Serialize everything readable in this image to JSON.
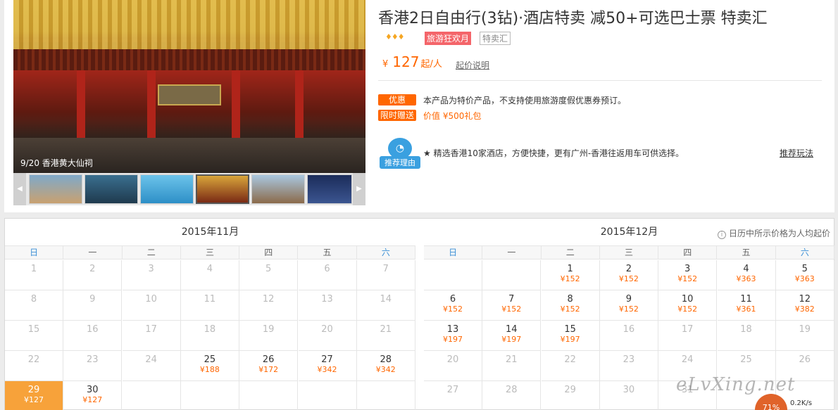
{
  "product": {
    "title": "香港2日自由行(3钻)·酒店特卖 减50+可选巴士票 特卖汇",
    "diamonds": "♦♦♦",
    "tag_promo": "旅游狂欢月",
    "tag_sale": "特卖汇",
    "price_currency": "¥",
    "price_value": "127",
    "price_unit": "起/人",
    "price_note": "起价说明",
    "discount_label": "优惠",
    "discount_text": "本产品为特价产品，不支持使用旅游度假优惠券预订。",
    "gift_label": "限时赠送",
    "gift_text": "价值 ¥500礼包",
    "reason_label": "推荐理由",
    "reason_text": "★ 精选香港10家酒店，方便快捷，更有广州-香港往返用车可供选择。",
    "reason_link": "推荐玩法",
    "hero_caption": "9/20 香港黄大仙祠"
  },
  "calendar": {
    "note": "日历中所示价格为人均起价",
    "weekdays": [
      "日",
      "一",
      "二",
      "三",
      "四",
      "五",
      "六"
    ],
    "months": [
      {
        "title": "2015年11月",
        "rows": [
          [
            {
              "d": "1"
            },
            {
              "d": "2"
            },
            {
              "d": "3"
            },
            {
              "d": "4"
            },
            {
              "d": "5"
            },
            {
              "d": "6"
            },
            {
              "d": "7"
            }
          ],
          [
            {
              "d": "8"
            },
            {
              "d": "9"
            },
            {
              "d": "10"
            },
            {
              "d": "11"
            },
            {
              "d": "12"
            },
            {
              "d": "13"
            },
            {
              "d": "14"
            }
          ],
          [
            {
              "d": "15"
            },
            {
              "d": "16"
            },
            {
              "d": "17"
            },
            {
              "d": "18"
            },
            {
              "d": "19"
            },
            {
              "d": "20"
            },
            {
              "d": "21"
            }
          ],
          [
            {
              "d": "22"
            },
            {
              "d": "23"
            },
            {
              "d": "24"
            },
            {
              "d": "25",
              "p": "¥188"
            },
            {
              "d": "26",
              "p": "¥172"
            },
            {
              "d": "27",
              "p": "¥342"
            },
            {
              "d": "28",
              "p": "¥342"
            }
          ],
          [
            {
              "d": "29",
              "p": "¥127",
              "sel": true
            },
            {
              "d": "30",
              "p": "¥127"
            },
            {
              "d": ""
            },
            {
              "d": ""
            },
            {
              "d": ""
            },
            {
              "d": ""
            },
            {
              "d": ""
            }
          ]
        ]
      },
      {
        "title": "2015年12月",
        "rows": [
          [
            {
              "d": ""
            },
            {
              "d": ""
            },
            {
              "d": "1",
              "p": "¥152"
            },
            {
              "d": "2",
              "p": "¥152"
            },
            {
              "d": "3",
              "p": "¥152"
            },
            {
              "d": "4",
              "p": "¥363"
            },
            {
              "d": "5",
              "p": "¥363"
            }
          ],
          [
            {
              "d": "6",
              "p": "¥152"
            },
            {
              "d": "7",
              "p": "¥152"
            },
            {
              "d": "8",
              "p": "¥152"
            },
            {
              "d": "9",
              "p": "¥152"
            },
            {
              "d": "10",
              "p": "¥152"
            },
            {
              "d": "11",
              "p": "¥361"
            },
            {
              "d": "12",
              "p": "¥382"
            }
          ],
          [
            {
              "d": "13",
              "p": "¥197"
            },
            {
              "d": "14",
              "p": "¥197"
            },
            {
              "d": "15",
              "p": "¥197"
            },
            {
              "d": "16"
            },
            {
              "d": "17"
            },
            {
              "d": "18"
            },
            {
              "d": "19"
            }
          ],
          [
            {
              "d": "20"
            },
            {
              "d": "21"
            },
            {
              "d": "22"
            },
            {
              "d": "23"
            },
            {
              "d": "24"
            },
            {
              "d": "25"
            },
            {
              "d": "26"
            }
          ],
          [
            {
              "d": "27"
            },
            {
              "d": "28"
            },
            {
              "d": "29"
            },
            {
              "d": "30"
            },
            {
              "d": "31"
            },
            {
              "d": ""
            },
            {
              "d": ""
            }
          ]
        ]
      }
    ]
  },
  "overlay": {
    "watermark": "eLvXing.net",
    "speed_percent": "71%",
    "speed_rate": "0.2K/s"
  },
  "colors": {
    "accent": "#ff6600",
    "weekend": "#3a8fd6",
    "selected": "#f7a23a"
  }
}
